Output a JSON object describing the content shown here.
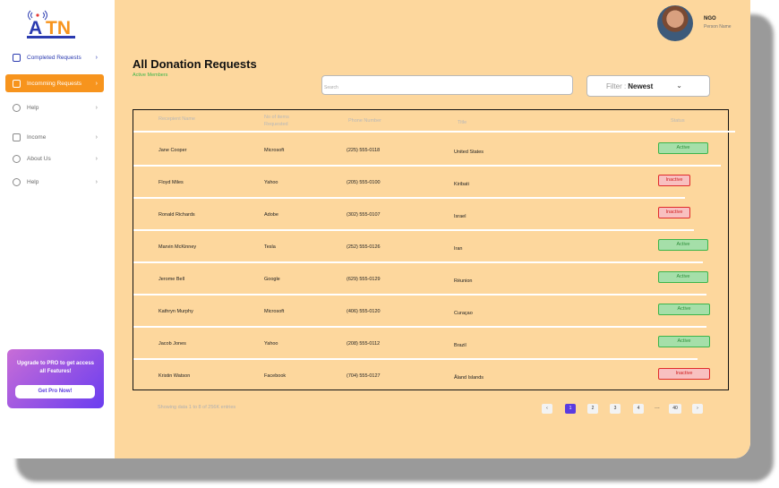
{
  "brand": {
    "logo_text": "ATN"
  },
  "sidebar": {
    "items": [
      {
        "label": "Completed Requests"
      },
      {
        "label": "Incomming Requests"
      },
      {
        "label": "Help"
      },
      {
        "label": "Income"
      },
      {
        "label": "About Us"
      },
      {
        "label": "Help"
      }
    ],
    "promo": {
      "text": "Upgrade to PRO to get access all Features!",
      "button": "Get Pro Now!"
    }
  },
  "user": {
    "role": "NGO",
    "name": "Person Name"
  },
  "page": {
    "title": "All Donation Requests",
    "subtitle": "Active Members"
  },
  "search": {
    "placeholder": "Search"
  },
  "filter": {
    "label": "Filter :",
    "value": "Newest"
  },
  "table": {
    "headers": [
      "Recepient Name",
      "No of items Requested",
      "Phone Number",
      "Title",
      "Status"
    ],
    "rows": [
      {
        "name": "Jane Cooper",
        "items": "Microsoft",
        "phone": "(225) 555-0118",
        "title": "United States",
        "status": "Active"
      },
      {
        "name": "Floyd Miles",
        "items": "Yahoo",
        "phone": "(205) 555-0100",
        "title": "Kiribati",
        "status": "Inactive"
      },
      {
        "name": "Ronald Richards",
        "items": "Adobe",
        "phone": "(302) 555-0107",
        "title": "Israel",
        "status": "Inactive"
      },
      {
        "name": "Marvin McKinney",
        "items": "Tesla",
        "phone": "(252) 555-0126",
        "title": "Iran",
        "status": "Active"
      },
      {
        "name": "Jerome Bell",
        "items": "Google",
        "phone": "(629) 555-0129",
        "title": "Réunion",
        "status": "Active"
      },
      {
        "name": "Kathryn Murphy",
        "items": "Microsoft",
        "phone": "(406) 555-0120",
        "title": "Curaçao",
        "status": "Active"
      },
      {
        "name": "Jacob Jones",
        "items": "Yahoo",
        "phone": "(208) 555-0112",
        "title": "Brazil",
        "status": "Active"
      },
      {
        "name": "Kristin Watson",
        "items": "Facebook",
        "phone": "(704) 555-0127",
        "title": "Åland Islands",
        "status": "Inactive"
      }
    ]
  },
  "footer": {
    "info": "Showing data 1 to 8 of 256K entries"
  },
  "pagination": {
    "prev": "‹",
    "pages": [
      "1",
      "2",
      "3",
      "4"
    ],
    "ellipsis": "...",
    "last": "40",
    "next": "›",
    "current": "1"
  },
  "colors": {
    "accent": "#f7941d",
    "main_bg": "#fdd79d",
    "active": "#3bb54a",
    "inactive": "#e02b2b",
    "pager_current": "#5a3be0"
  }
}
